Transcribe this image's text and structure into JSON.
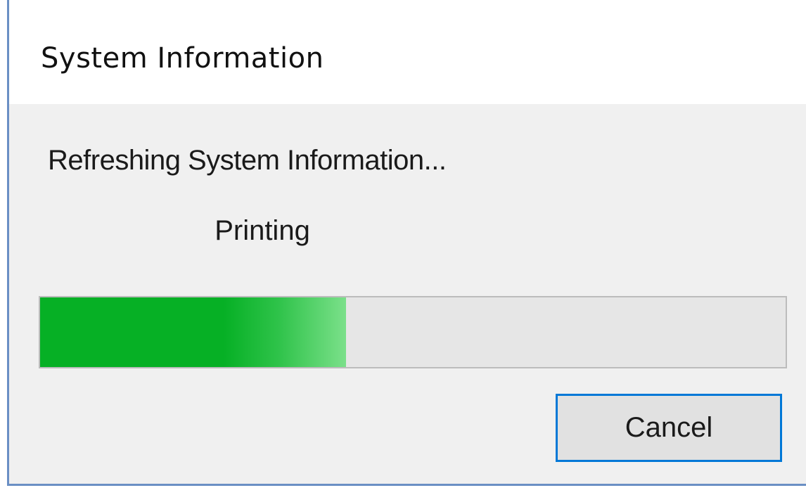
{
  "window": {
    "title": "System Information"
  },
  "dialog": {
    "status_message": "Refreshing System Information...",
    "current_item": "Printing",
    "progress": {
      "fraction": 0.41,
      "fill_color": "#06b025",
      "track_color": "#e6e6e6"
    },
    "cancel_label": "Cancel",
    "focus_color": "#0078d7"
  }
}
